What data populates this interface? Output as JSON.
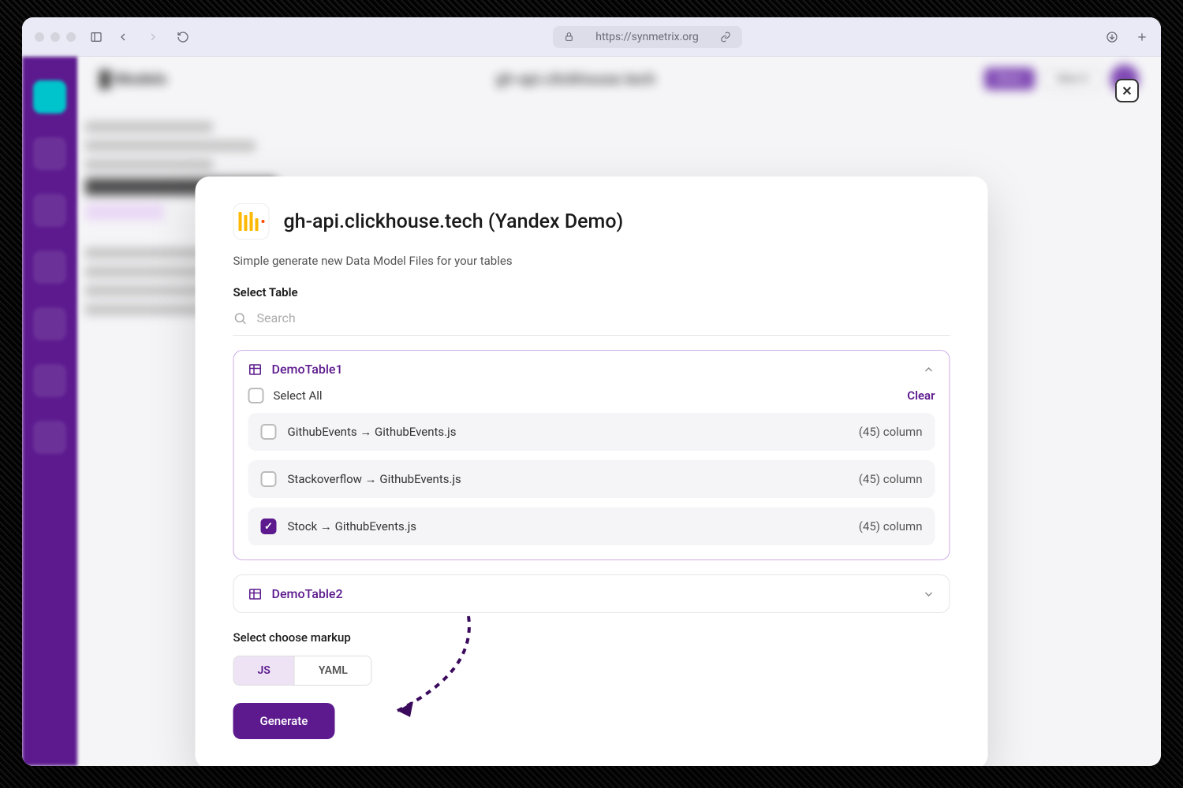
{
  "browser": {
    "url": "https://synmetrix.org"
  },
  "close_badge": "✕",
  "modal": {
    "title": "gh-api.clickhouse.tech (Yandex Demo)",
    "subtitle": "Simple generate new Data Model Files for your tables",
    "select_table_label": "Select Table",
    "search_placeholder": "Search",
    "groups": [
      {
        "name": "DemoTable1",
        "expanded": true,
        "select_all_label": "Select All",
        "clear_label": "Clear",
        "rows": [
          {
            "name": "GithubEvents → GithubEvents.js",
            "count": "(45) column",
            "checked": false
          },
          {
            "name": "Stackoverflow → GithubEvents.js",
            "count": "(45) column",
            "checked": false
          },
          {
            "name": "Stock → GithubEvents.js",
            "count": "(45) column",
            "checked": true
          }
        ]
      },
      {
        "name": "DemoTable2",
        "expanded": false
      }
    ],
    "markup_label": "Select choose markup",
    "markup_options": {
      "js": "JS",
      "yaml": "YAML"
    },
    "generate_label": "Generate"
  }
}
